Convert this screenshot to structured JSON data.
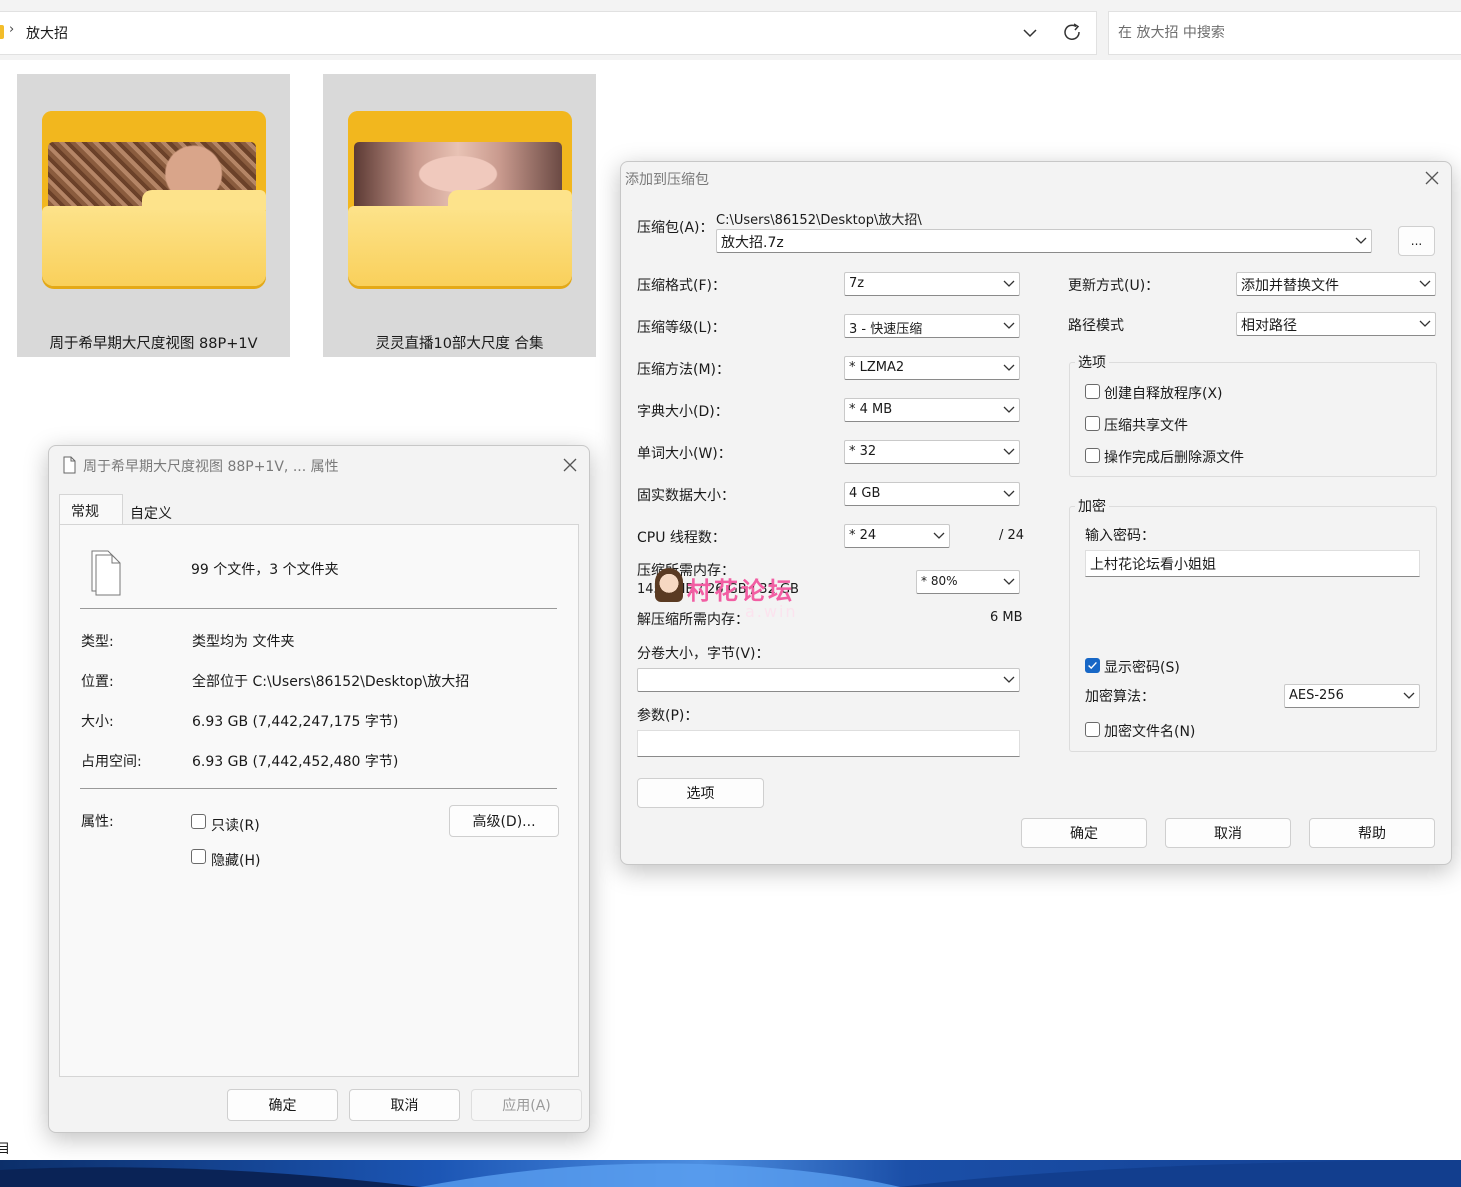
{
  "explorer": {
    "breadcrumb": "放大招",
    "search_placeholder": "在 放大招 中搜索",
    "folders": [
      {
        "name": "周于希早期大尺度视图 88P+1V"
      },
      {
        "name": "灵灵直播10部大尺度 合集"
      }
    ],
    "edge_char": "目"
  },
  "properties_dialog": {
    "title": "周于希早期大尺度视图 88P+1V, ... 属性",
    "tabs": [
      "常规",
      "自定义"
    ],
    "summary": "99 个文件，3 个文件夹",
    "rows": [
      {
        "label": "类型:",
        "value": "类型均为 文件夹"
      },
      {
        "label": "位置:",
        "value": "全部位于 C:\\Users\\86152\\Desktop\\放大招"
      },
      {
        "label": "大小:",
        "value": "6.93 GB (7,442,247,175 字节)"
      },
      {
        "label": "占用空间:",
        "value": "6.93 GB (7,442,452,480 字节)"
      }
    ],
    "attributes_label": "属性:",
    "readonly_label": "只读(R)",
    "hidden_label": "隐藏(H)",
    "advanced_button": "高级(D)...",
    "ok": "确定",
    "cancel": "取消",
    "apply": "应用(A)"
  },
  "archive_dialog": {
    "title": "添加到压缩包",
    "archive_label": "压缩包(A)：",
    "archive_path": "C:\\Users\\86152\\Desktop\\放大招\\",
    "archive_name": "放大招.7z",
    "browse_button": "...",
    "format_label": "压缩格式(F)：",
    "format_value": "7z",
    "level_label": "压缩等级(L)：",
    "level_value": "3 - 快速压缩",
    "method_label": "压缩方法(M)：",
    "method_value": "* LZMA2",
    "dict_label": "字典大小(D)：",
    "dict_value": "* 4 MB",
    "word_label": "单词大小(W)：",
    "word_value": "* 32",
    "solid_label": "固实数据大小：",
    "solid_value": "4 GB",
    "cpu_label": "CPU 线程数：",
    "cpu_value": "* 24",
    "cpu_max": "/ 24",
    "mem_comp_label": "压缩所需内存：",
    "mem_comp_values": "1450 MB / 26 GB / 32 GB",
    "mem_percent": "* 80%",
    "mem_decomp_label": "解压缩所需内存：",
    "mem_decomp_value": "6 MB",
    "volume_label": "分卷大小，字节(V)：",
    "volume_value": "",
    "params_label": "参数(P)：",
    "params_value": "",
    "options_button": "选项",
    "update_label": "更新方式(U)：",
    "update_value": "添加并替换文件",
    "path_label": "路径模式",
    "path_value": "相对路径",
    "options_group": "选项",
    "opt_sfx": "创建自释放程序(X)",
    "opt_shared": "压缩共享文件",
    "opt_delete": "操作完成后删除源文件",
    "encrypt_group": "加密",
    "password_label": "输入密码：",
    "password_value": "上村花论坛看小姐姐",
    "show_password": "显示密码(S)",
    "enc_method_label": "加密算法：",
    "enc_method_value": "AES-256",
    "enc_names": "加密文件名(N)",
    "ok": "确定",
    "cancel": "取消",
    "help": "帮助"
  },
  "watermark": {
    "text": "村花论坛",
    "sub": "a.win"
  }
}
